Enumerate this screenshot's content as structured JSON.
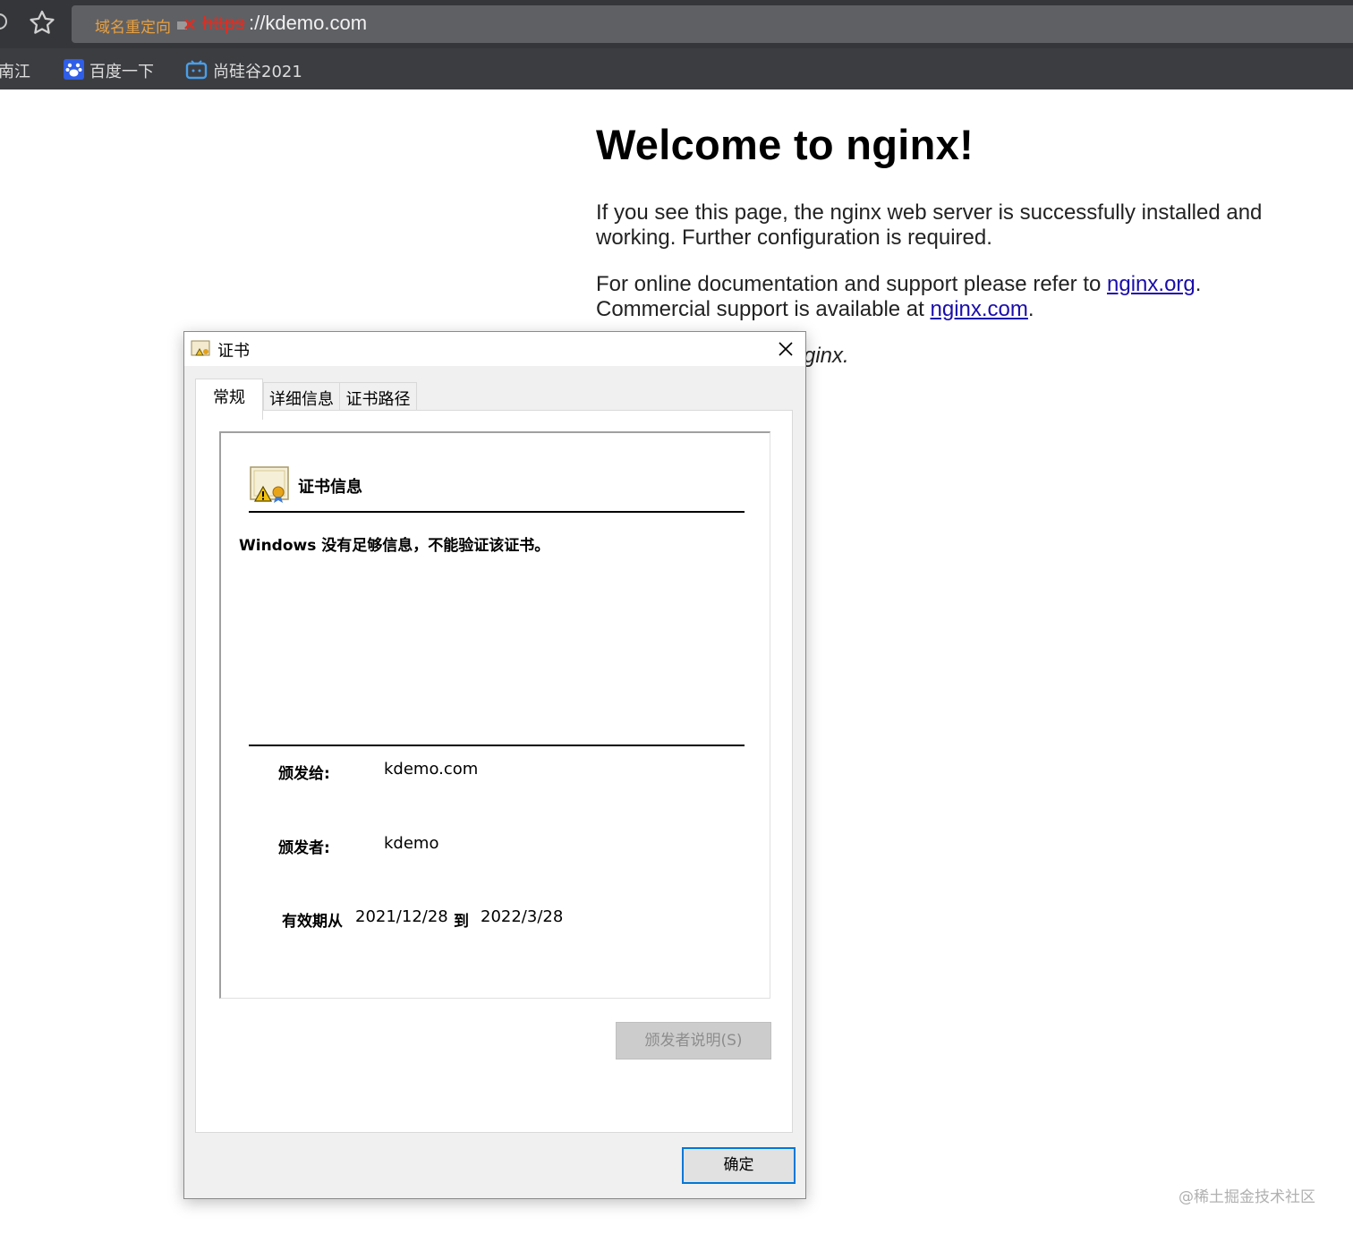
{
  "browser": {
    "redirect_label": "域名重定向",
    "url_scheme": "https",
    "url_rest": "://kdemo.com",
    "bookmarks": [
      {
        "label": "南江"
      },
      {
        "label": "百度一下"
      },
      {
        "label": "尚硅谷2021"
      }
    ]
  },
  "page": {
    "title": "Welcome to nginx!",
    "p1": "If you see this page, the nginx web server is successfully installed and working. Further configuration is required.",
    "p2_text": "For online documentation and support please refer to ",
    "p2_link": "nginx.org",
    "p2_mid": ".\nCommercial support is available at ",
    "p2_link2": "nginx.com",
    "p2_end": ".",
    "p3_partial": "ginx."
  },
  "dialog": {
    "title": "证书",
    "tabs": [
      {
        "label": "常规"
      },
      {
        "label": "详细信息"
      },
      {
        "label": "证书路径"
      }
    ],
    "info_heading": "证书信息",
    "warning": "Windows 没有足够信息，不能验证该证书。",
    "issued_to_label": "颁发给:",
    "issued_to": "kdemo.com",
    "issued_by_label": "颁发者:",
    "issued_by": "kdemo",
    "valid_label": "有效期从",
    "valid_from": "2021/12/28",
    "valid_to_label": "到",
    "valid_to": "2022/3/28",
    "issuer_statement_button": "颁发者说明(S)",
    "ok_button": "确定"
  },
  "watermark": "@稀土掘金技术社区",
  "colors": {
    "chrome_dark": "#35363a",
    "address_bar": "#5f6064",
    "link": "#1a0dab",
    "insecure_red": "#d93025",
    "focus_blue": "#0078d7"
  }
}
